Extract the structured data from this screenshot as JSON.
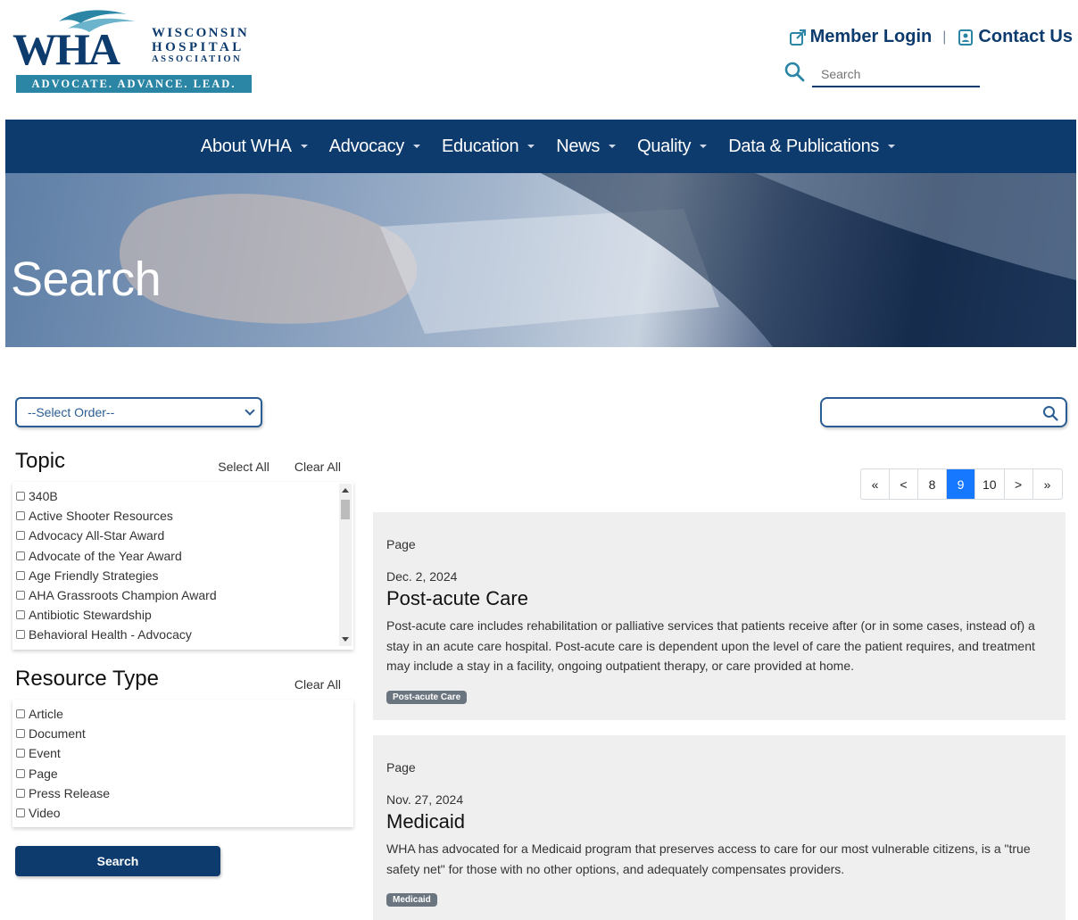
{
  "logo": {
    "mark": "WHA",
    "name_line1": "WISCONSIN",
    "name_line2": "HOSPITAL",
    "name_line3": "ASSOCIATION",
    "tagline": "ADVOCATE. ADVANCE. LEAD."
  },
  "header": {
    "member_login": "Member Login",
    "separator": "|",
    "contact_us": "Contact Us",
    "search_placeholder": "Search"
  },
  "nav": {
    "items": [
      {
        "label": "About WHA"
      },
      {
        "label": "Advocacy"
      },
      {
        "label": "Education"
      },
      {
        "label": "News"
      },
      {
        "label": "Quality"
      },
      {
        "label": "Data & Publications"
      }
    ]
  },
  "hero": {
    "title": "Search"
  },
  "filters": {
    "order_select": "--Select Order--",
    "topic": {
      "title": "Topic",
      "select_all": "Select All",
      "clear_all": "Clear All",
      "items": [
        {
          "label": "340B"
        },
        {
          "label": "Active Shooter Resources"
        },
        {
          "label": "Advocacy All-Star Award"
        },
        {
          "label": "Advocate of the Year Award"
        },
        {
          "label": "Age Friendly Strategies"
        },
        {
          "label": "AHA Grassroots Champion Award"
        },
        {
          "label": "Antibiotic Stewardship"
        },
        {
          "label": "Behavioral Health - Advocacy"
        }
      ]
    },
    "resource_type": {
      "title": "Resource Type",
      "clear_all": "Clear All",
      "items": [
        {
          "label": "Article"
        },
        {
          "label": "Document"
        },
        {
          "label": "Event"
        },
        {
          "label": "Page"
        },
        {
          "label": "Press Release"
        },
        {
          "label": "Video"
        }
      ]
    },
    "search_button": "Search"
  },
  "pagination": {
    "first": "«",
    "prev": "<",
    "pages": [
      "8",
      "9",
      "10"
    ],
    "current": "9",
    "next": ">",
    "last": "»"
  },
  "results": [
    {
      "kind": "Page",
      "date": "Dec. 2, 2024",
      "title": "Post-acute Care",
      "description": "Post-acute care includes rehabilitation or palliative services that patients receive after (or in some cases, instead of) a stay in an acute care hospital. Post-acute care is dependent upon the level of care the patient requires, and treatment may include a stay in a facility, ongoing outpatient therapy, or care provided at home.",
      "tag": "Post-acute Care"
    },
    {
      "kind": "Page",
      "date": "Nov. 27, 2024",
      "title": "Medicaid",
      "description": "WHA has advocated for a Medicaid program that preserves access to care for our most vulnerable citizens, is a \"true safety net\" for those with no other options, and adequately compensates providers.",
      "tag": "Medicaid"
    }
  ],
  "colors": {
    "brand_navy": "#0d3b6e",
    "brand_teal": "#2b86a6",
    "accent_blue": "#1677ff",
    "card_bg": "#efefef",
    "tag_bg": "#6b7580"
  }
}
